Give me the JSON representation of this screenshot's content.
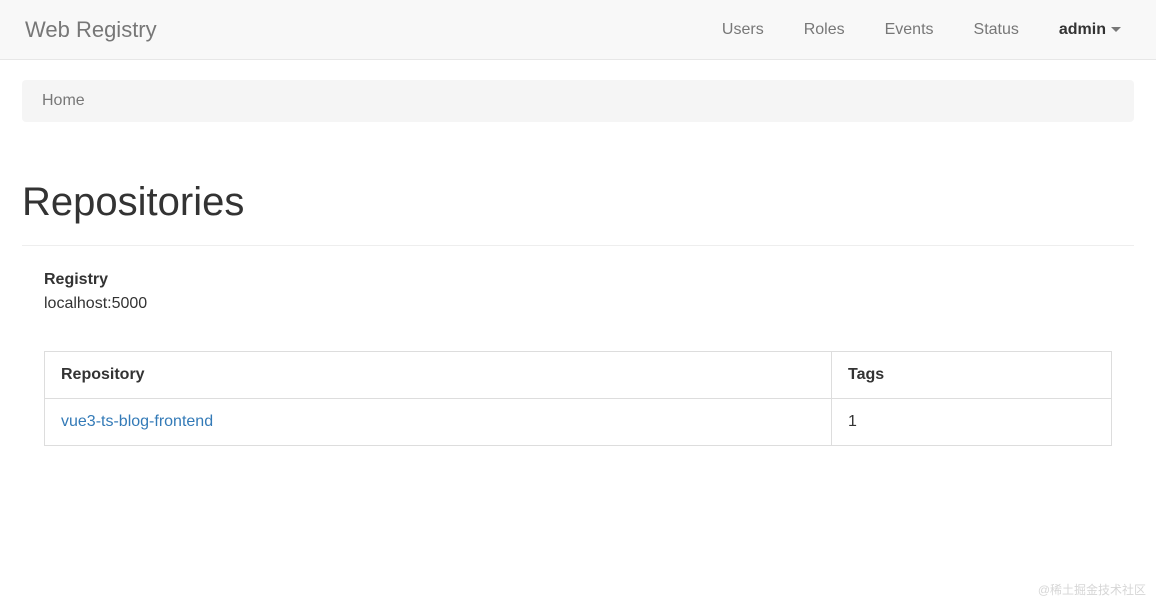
{
  "navbar": {
    "brand": "Web Registry",
    "items": [
      "Users",
      "Roles",
      "Events",
      "Status"
    ],
    "user": "admin"
  },
  "breadcrumb": {
    "items": [
      "Home"
    ]
  },
  "page": {
    "title": "Repositories"
  },
  "registry": {
    "label": "Registry",
    "value": "localhost:5000"
  },
  "table": {
    "headers": [
      "Repository",
      "Tags"
    ],
    "rows": [
      {
        "repository": "vue3-ts-blog-frontend",
        "tags": "1"
      }
    ]
  },
  "watermark": "@稀土掘金技术社区"
}
